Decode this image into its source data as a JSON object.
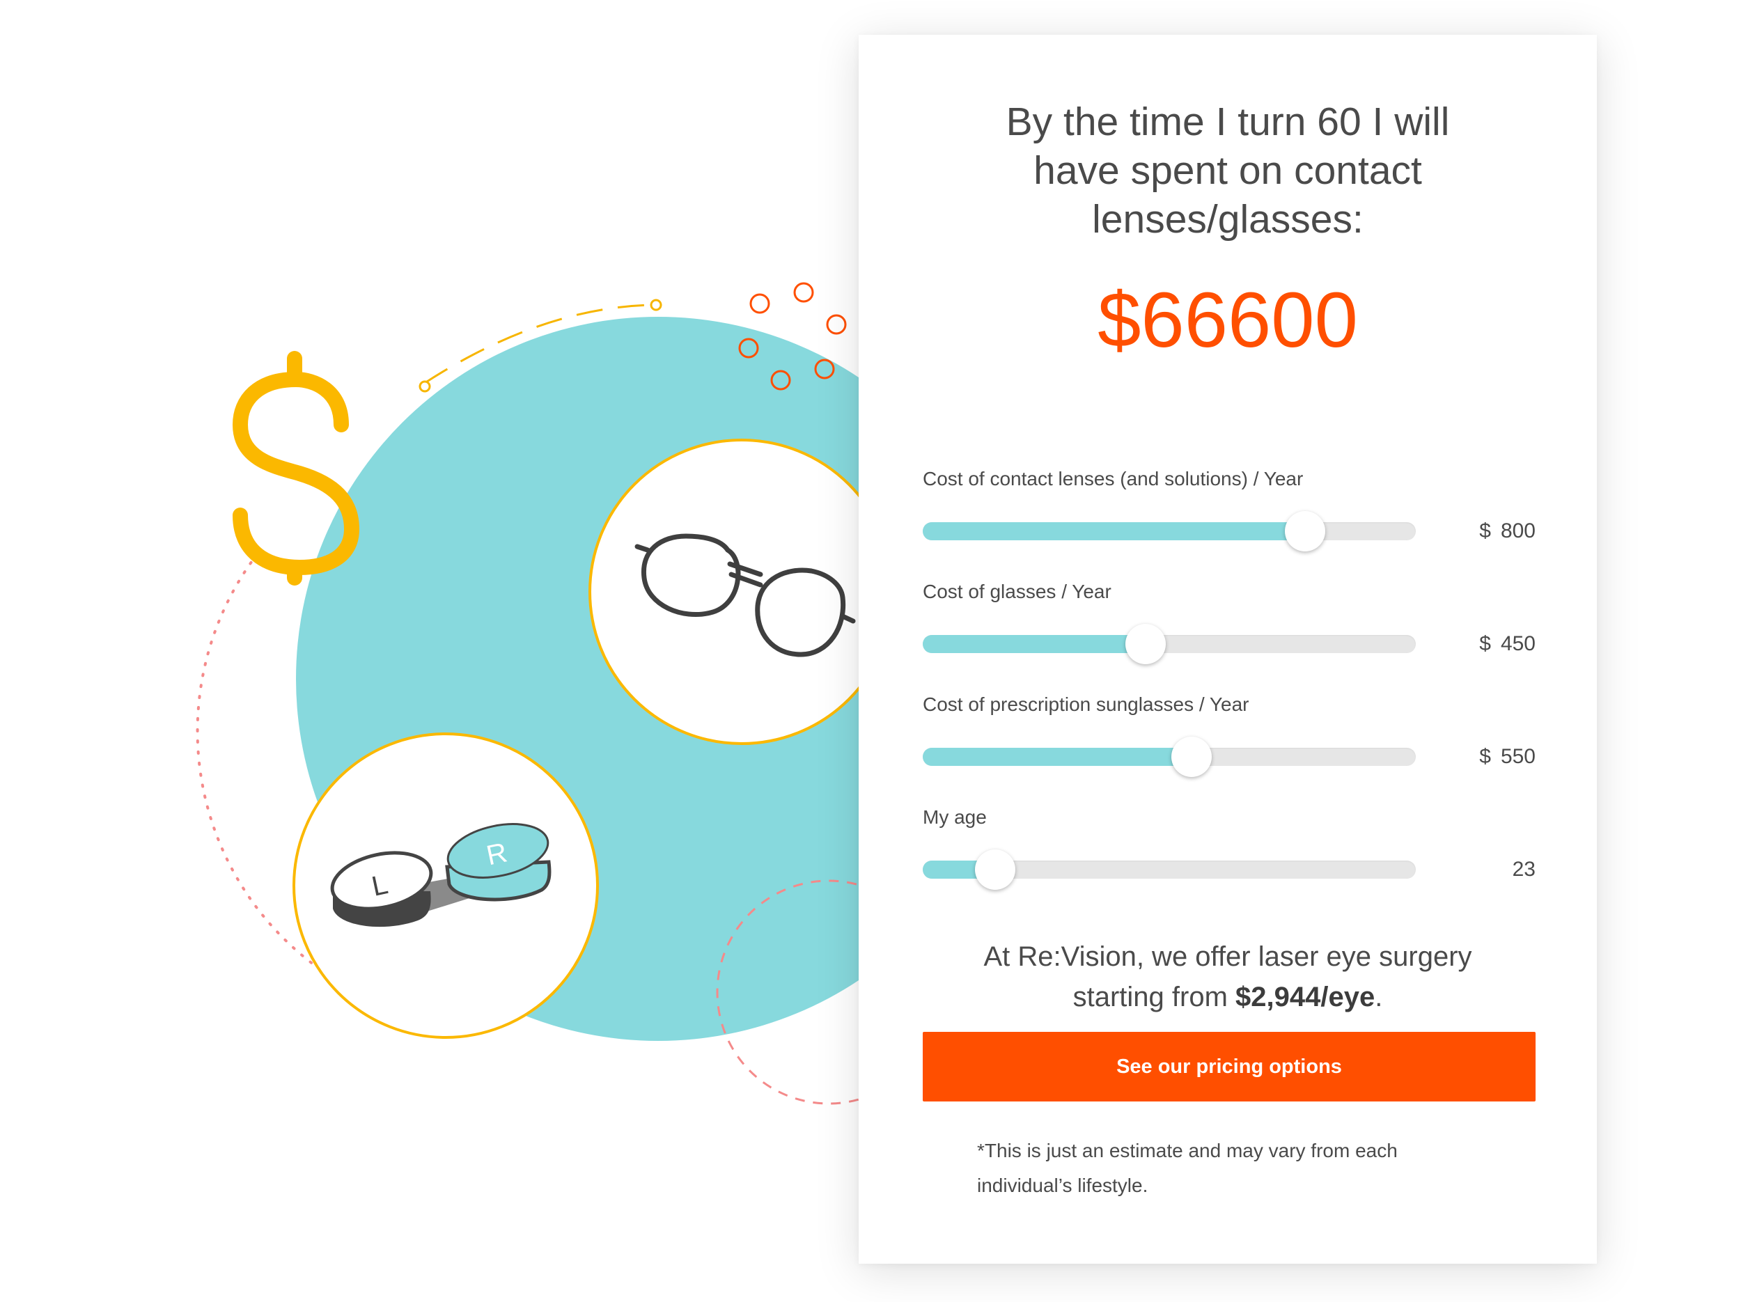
{
  "headline": {
    "line1": "By the time I turn 60 I will",
    "line2": "have spent on contact",
    "line3": "lenses/glasses:"
  },
  "total": "$66600",
  "sliders": [
    {
      "label": "Cost of contact lenses (and solutions) / Year",
      "currency": "$",
      "value": "800",
      "level": 0.775
    },
    {
      "label": "Cost of glasses / Year",
      "currency": "$",
      "value": "450",
      "level": 0.452
    },
    {
      "label": "Cost of prescription sunglasses / Year",
      "currency": "$",
      "value": "550",
      "level": 0.545
    },
    {
      "label": "My age",
      "currency": "",
      "value": "23",
      "level": 0.147
    }
  ],
  "promo": {
    "line1": "At Re:Vision, we offer laser eye surgery",
    "line2_prefix": "starting from ",
    "price": "$2,944/eye",
    "line2_suffix": "."
  },
  "cta_label": "See our pricing options",
  "disclaimer": "*This is just an estimate and may vary from each individual’s lifestyle.",
  "illustration": {
    "case_left_letter": "L",
    "case_right_letter": "R",
    "icons": [
      "dollar-sign-icon",
      "glasses-icon",
      "contact-lens-case-icon"
    ]
  },
  "colors": {
    "accent": "#ff4f00",
    "teal": "#87d9dd",
    "yellow": "#fbb800",
    "text": "#4a4a4a",
    "track": "#e6e6e6"
  }
}
